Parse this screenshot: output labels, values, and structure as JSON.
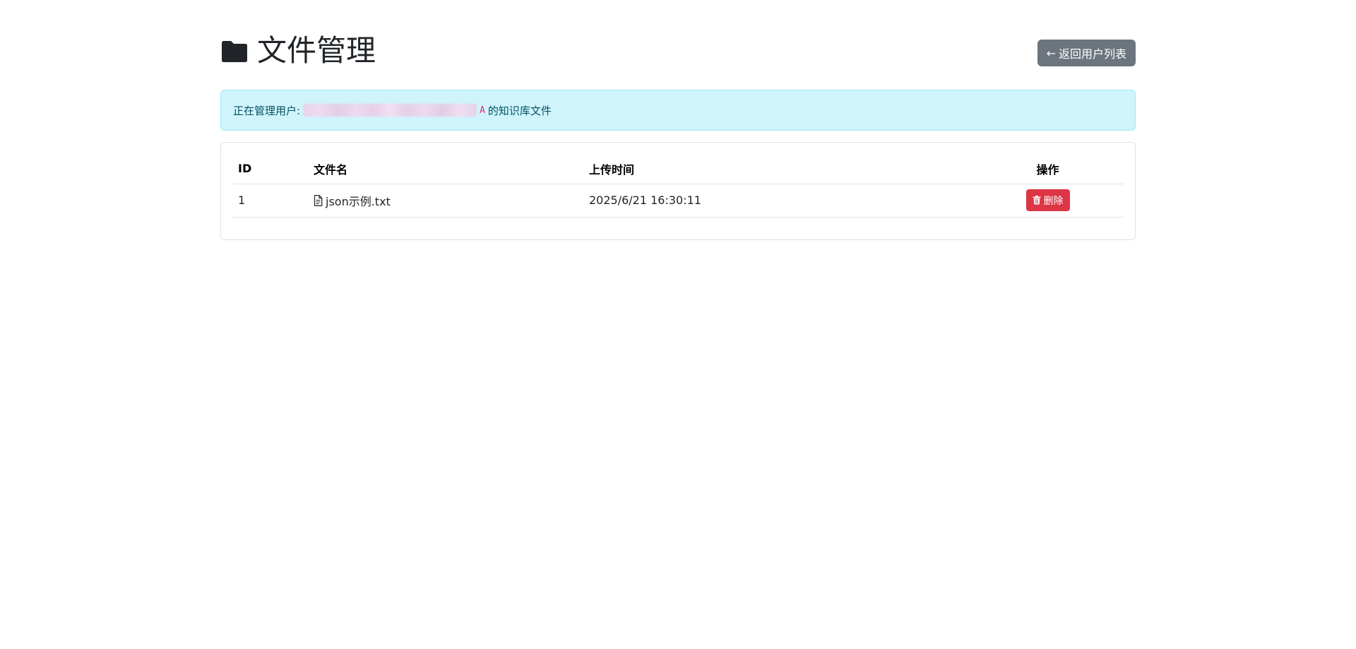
{
  "header": {
    "title": "文件管理",
    "title_icon": "folder-icon",
    "back_button_arrow": "←",
    "back_button_label": "返回用户列表"
  },
  "alert": {
    "prefix": "正在管理用户:",
    "user_code_visible": "A",
    "suffix": "的知识库文件"
  },
  "table": {
    "columns": [
      "ID",
      "文件名",
      "上传时间",
      "操作"
    ],
    "rows": [
      {
        "id": "1",
        "file_name": "json示例.txt",
        "file_icon": "file-text-icon",
        "uploaded_at": "2025/6/21 16:30:11",
        "action_label": "删除",
        "action_icon": "trash-icon"
      }
    ]
  },
  "colors": {
    "alert_bg": "#cff4fc",
    "alert_text": "#055160",
    "code_text": "#d63384",
    "secondary_button": "#6c757d",
    "danger_button": "#dc3545"
  }
}
